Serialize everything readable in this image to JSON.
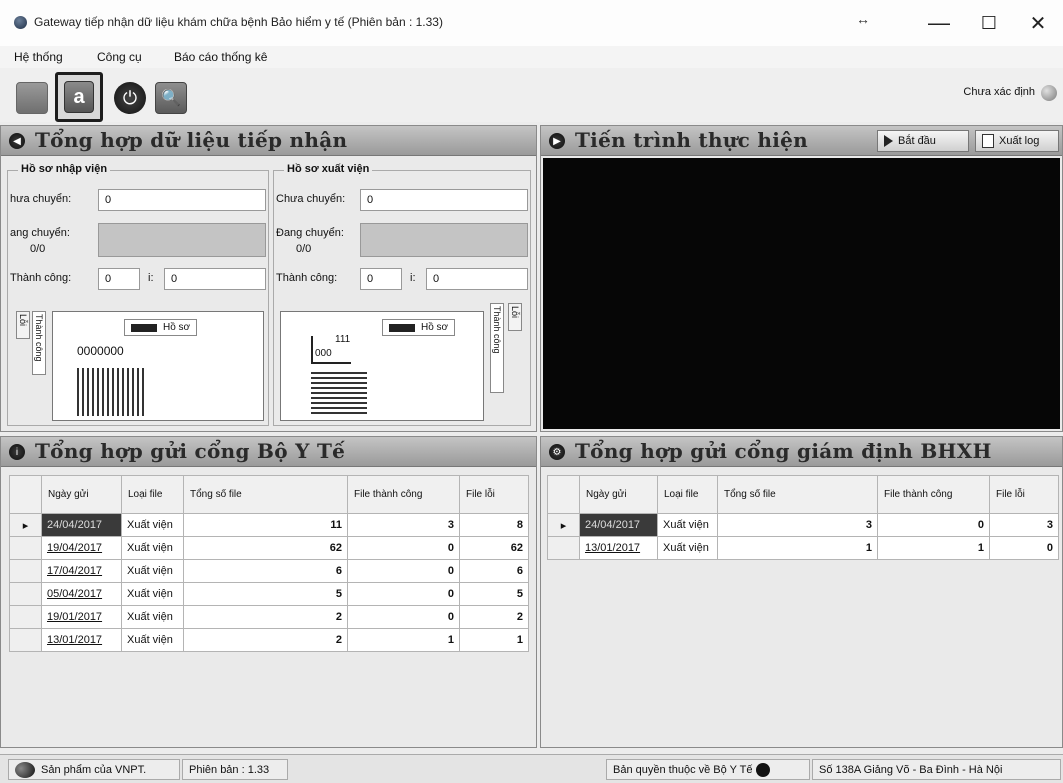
{
  "window": {
    "title": "Gateway tiếp nhận dữ liệu khám chữa bệnh Bảo hiểm y tế (Phiên bản : 1.33)",
    "resize_glyph": "↔",
    "minimize": "—",
    "maximize": "☐",
    "close": "✕"
  },
  "menu": [
    "Hệ thống",
    "Công cụ",
    "Báo cáo thống kê"
  ],
  "toolbar": {
    "lock_glyph": "a",
    "power_glyph": "⏻",
    "search_glyph": "🔍",
    "status_text": "Chưa xác định"
  },
  "panel_summary": {
    "title": "Tổng hợp dữ liệu tiếp nhận",
    "icon": "◀",
    "inpatient": {
      "label": "Hồ sơ nhập viện",
      "pending_label": "hưa chuyển:",
      "pending_value": "0",
      "sending_label": "ang chuyển:",
      "sending_progress": "0/0",
      "success_label": "Thành công:",
      "success_value": "0",
      "error_label": "i:",
      "error_value": "0",
      "legend": "Hồ sơ",
      "chart_text": "0000000",
      "tab_error": "Lỗi",
      "tab_success": "Thành công"
    },
    "outpatient": {
      "label": "Hồ sơ xuất viện",
      "pending_label": "Chưa chuyển:",
      "pending_value": "0",
      "sending_label": "Đang chuyển:",
      "sending_progress": "0/0",
      "success_label": "Thành công:",
      "success_value": "0",
      "error_label": "i:",
      "error_value": "0",
      "legend": "Hồ sơ",
      "chart_text_a": "111",
      "chart_text_b": "000",
      "tab_error": "Lỗi",
      "tab_success": "Thành công"
    }
  },
  "panel_progress": {
    "title": "Tiến trình thực hiện",
    "start_button": "Bắt đầu",
    "export_button": "Xuất log"
  },
  "panel_moh": {
    "title": "Tổng hợp gửi cổng Bộ Y Tế",
    "columns": [
      "Ngày gửi",
      "Loại file",
      "Tổng số file",
      "File thành công",
      "File lỗi"
    ],
    "rows": [
      {
        "date": "24/04/2017",
        "type": "Xuất viện",
        "total": "11",
        "ok": "3",
        "err": "8"
      },
      {
        "date": "19/04/2017",
        "type": "Xuất viện",
        "total": "62",
        "ok": "0",
        "err": "62"
      },
      {
        "date": "17/04/2017",
        "type": "Xuất viện",
        "total": "6",
        "ok": "0",
        "err": "6"
      },
      {
        "date": "05/04/2017",
        "type": "Xuất viện",
        "total": "5",
        "ok": "0",
        "err": "5"
      },
      {
        "date": "19/01/2017",
        "type": "Xuất viện",
        "total": "2",
        "ok": "0",
        "err": "2"
      },
      {
        "date": "13/01/2017",
        "type": "Xuất viện",
        "total": "2",
        "ok": "1",
        "err": "1"
      }
    ]
  },
  "panel_bhxh": {
    "title": "Tổng hợp gửi cổng giám định BHXH",
    "columns": [
      "Ngày gửi",
      "Loại file",
      "Tổng số file",
      "File thành công",
      "File lỗi"
    ],
    "rows": [
      {
        "date": "24/04/2017",
        "type": "Xuất viện",
        "total": "3",
        "ok": "0",
        "err": "3"
      },
      {
        "date": "13/01/2017",
        "type": "Xuất viện",
        "total": "1",
        "ok": "1",
        "err": "0"
      }
    ]
  },
  "statusbar": {
    "product": "Sản phẩm của VNPT.",
    "version": "Phiên bản : 1.33",
    "copyright": "Bản quyền thuộc về Bộ Y Tế",
    "address": "Số 138A Giảng Võ - Ba Đình - Hà Nội"
  }
}
